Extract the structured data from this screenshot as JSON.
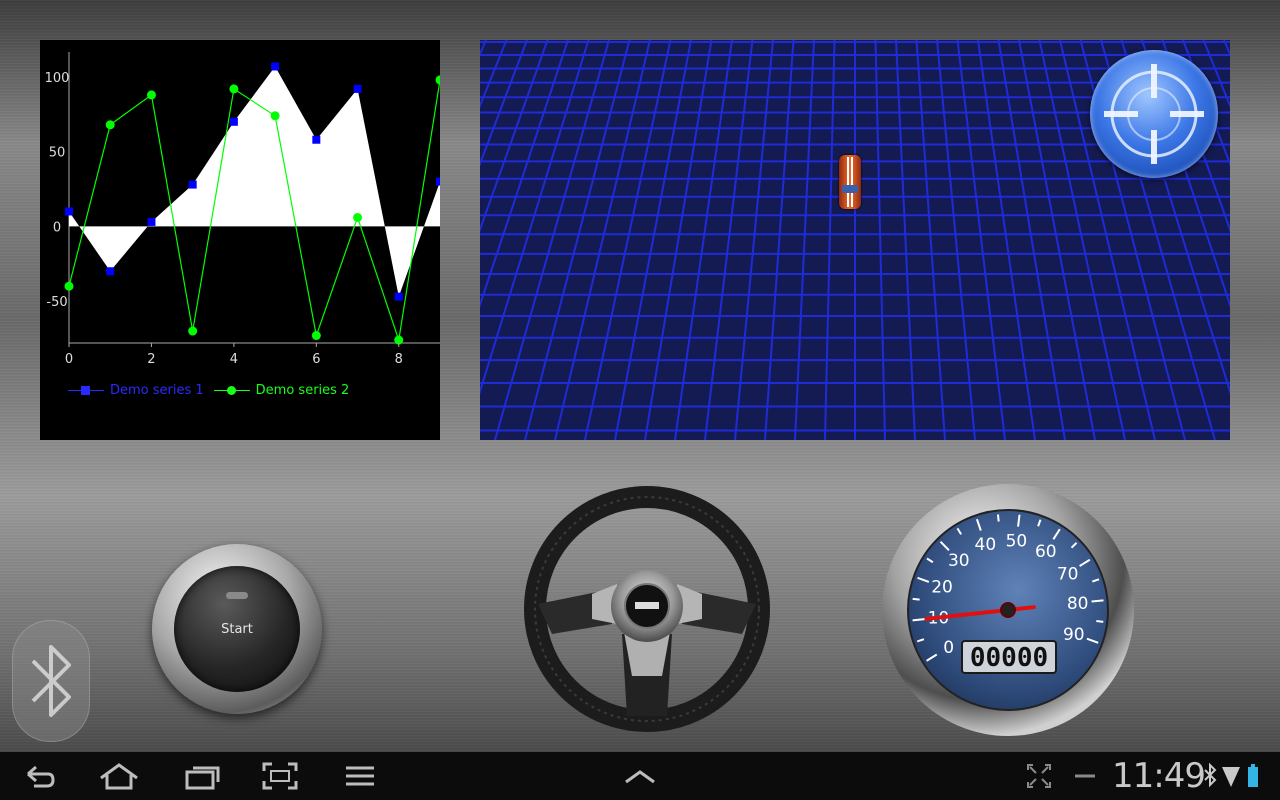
{
  "chart_data": {
    "type": "line",
    "x": [
      0,
      1,
      2,
      3,
      4,
      5,
      6,
      7,
      8,
      9
    ],
    "series": [
      {
        "name": "Demo series 1",
        "color": "#0000ff",
        "marker": "square",
        "fill": "white",
        "values": [
          10,
          -30,
          3,
          28,
          70,
          107,
          58,
          92,
          -47,
          30
        ]
      },
      {
        "name": "Demo series 2",
        "color": "#00ff00",
        "marker": "circle",
        "values": [
          -40,
          68,
          88,
          -70,
          92,
          74,
          -73,
          6,
          -76,
          98
        ]
      }
    ],
    "xticks": [
      "0",
      "2",
      "4",
      "6",
      "8"
    ],
    "yticks": [
      "100",
      "50",
      "0",
      "-50"
    ],
    "xlim": [
      0,
      9
    ],
    "ylim": [
      -78,
      110
    ],
    "legend_position": "bottom"
  },
  "start_button": {
    "label": "Start"
  },
  "speedometer": {
    "ticks": [
      "0",
      "10",
      "20",
      "30",
      "40",
      "50",
      "60",
      "70",
      "80",
      "90"
    ],
    "odometer": "00000",
    "needle_value": 10
  },
  "status_bar": {
    "time": "11:49"
  },
  "icons": {
    "bluetooth": "bluetooth-icon",
    "back": "back-icon",
    "home": "home-icon",
    "recent": "recent-apps-icon",
    "screenshot": "screenshot-icon",
    "menu": "menu-icon",
    "up": "chevron-up-icon",
    "fullscreen": "fullscreen-icon",
    "minus": "minus-icon",
    "wifi": "wifi-icon",
    "battery": "battery-icon"
  }
}
